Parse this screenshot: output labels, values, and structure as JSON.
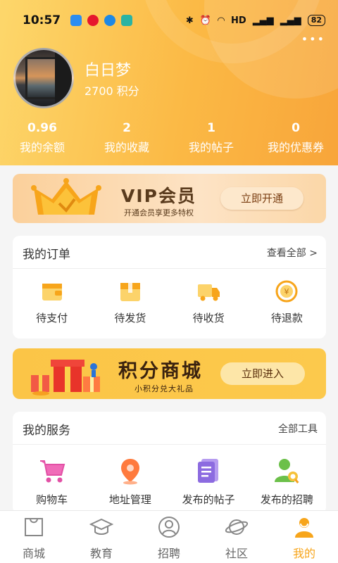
{
  "status": {
    "time": "10:57",
    "right_text": "HD",
    "battery": "82"
  },
  "profile": {
    "name": "白日梦",
    "points": "2700 积分"
  },
  "stats": [
    {
      "num": "0.96",
      "label": "我的余额"
    },
    {
      "num": "2",
      "label": "我的收藏"
    },
    {
      "num": "1",
      "label": "我的帖子"
    },
    {
      "num": "0",
      "label": "我的优惠券"
    }
  ],
  "vip": {
    "title": "VIP会员",
    "subtitle": "开通会员享更多特权",
    "button": "立即开通"
  },
  "orders": {
    "title": "我的订单",
    "link": "查看全部 >",
    "items": [
      {
        "label": "待支付",
        "icon": "wallet-icon"
      },
      {
        "label": "待发货",
        "icon": "package-icon"
      },
      {
        "label": "待收货",
        "icon": "truck-icon"
      },
      {
        "label": "待退款",
        "icon": "refund-icon"
      }
    ]
  },
  "mall": {
    "title": "积分商城",
    "subtitle": "小积分兑大礼品",
    "button": "立即进入"
  },
  "services": {
    "title": "我的服务",
    "link": "全部工具",
    "items": [
      {
        "label": "购物车",
        "icon": "cart-icon"
      },
      {
        "label": "地址管理",
        "icon": "location-icon"
      },
      {
        "label": "发布的帖子",
        "icon": "post-icon"
      },
      {
        "label": "发布的招聘",
        "icon": "recruit-icon"
      }
    ]
  },
  "tabs": [
    {
      "label": "商城",
      "icon": "shop-bag-icon"
    },
    {
      "label": "教育",
      "icon": "graduation-cap-icon"
    },
    {
      "label": "招聘",
      "icon": "person-circle-icon"
    },
    {
      "label": "社区",
      "icon": "planet-icon"
    },
    {
      "label": "我的",
      "icon": "user-icon",
      "active": true
    }
  ],
  "colors": {
    "accent": "#f7a51b",
    "header": "#fbb945"
  }
}
